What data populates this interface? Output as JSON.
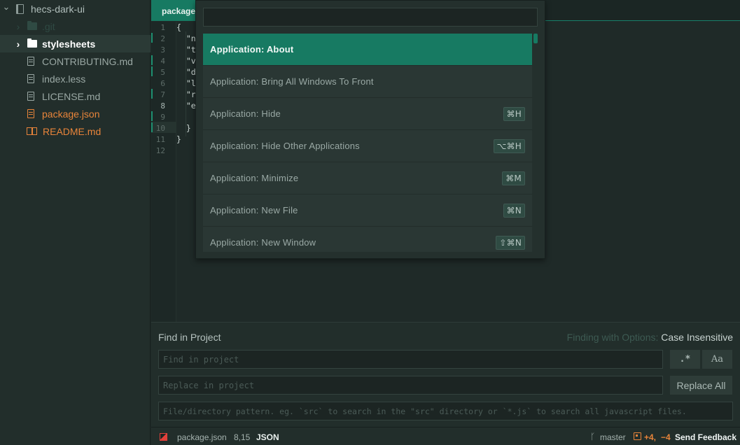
{
  "tree": {
    "items": [
      {
        "label": "hecs-dark-ui",
        "type": "repo",
        "chevron": "⌄",
        "color": "#9aa8a4"
      },
      {
        "label": ".git",
        "type": "folder",
        "chevron": "›",
        "color": "#2f4a43"
      },
      {
        "label": "stylesheets",
        "type": "folder",
        "chevron": "›",
        "color": "#ffffff"
      },
      {
        "label": "CONTRIBUTING.md",
        "type": "file",
        "color": "#9aa8a4"
      },
      {
        "label": "index.less",
        "type": "file",
        "color": "#9aa8a4"
      },
      {
        "label": "LICENSE.md",
        "type": "file",
        "color": "#9aa8a4"
      },
      {
        "label": "package.json",
        "type": "file",
        "color": "#e8843a"
      },
      {
        "label": "README.md",
        "type": "readme",
        "color": "#e8843a"
      }
    ]
  },
  "editor": {
    "tab_label": "package.json",
    "line_numbers": [
      "1",
      "2",
      "3",
      "4",
      "5",
      "6",
      "7",
      "8",
      "9",
      "10",
      "11",
      "12"
    ],
    "current_line": "8",
    "code_lines": [
      "{",
      "  \"n",
      "  \"t",
      "  \"v",
      "  \"d",
      "  \"l",
      "  \"r",
      "  \"e",
      "",
      "  }",
      "}",
      ""
    ]
  },
  "palette": {
    "input_value": "",
    "items": [
      {
        "label": "Application: About",
        "shortcut": ""
      },
      {
        "label": "Application: Bring All Windows To Front",
        "shortcut": ""
      },
      {
        "label": "Application: Hide",
        "shortcut": "⌘H"
      },
      {
        "label": "Application: Hide Other Applications",
        "shortcut": "⌥⌘H"
      },
      {
        "label": "Application: Minimize",
        "shortcut": "⌘M"
      },
      {
        "label": "Application: New File",
        "shortcut": "⌘N"
      },
      {
        "label": "Application: New Window",
        "shortcut": "⇧⌘N"
      }
    ]
  },
  "find": {
    "title": "Find in Project",
    "options_prefix": "Finding with Options:",
    "options_value": "Case Insensitive",
    "find_placeholder": "Find in project",
    "replace_placeholder": "Replace in project",
    "path_placeholder": "File/directory pattern. eg. `src` to search in the \"src\" directory or `*.js` to search all javascript files.",
    "regex_label": ".*",
    "case_label": "Aa",
    "replace_all_label": "Replace All"
  },
  "status": {
    "file": "package.json",
    "cursor": "8,15",
    "grammar": "JSON",
    "branch": "master",
    "diff_added": "+4,",
    "diff_removed": "−4",
    "feedback": "Send Feedback"
  },
  "colors": {
    "accent": "#177a62",
    "modified": "#e8843a",
    "added": "#e8843a",
    "removed": "#e0403a"
  }
}
